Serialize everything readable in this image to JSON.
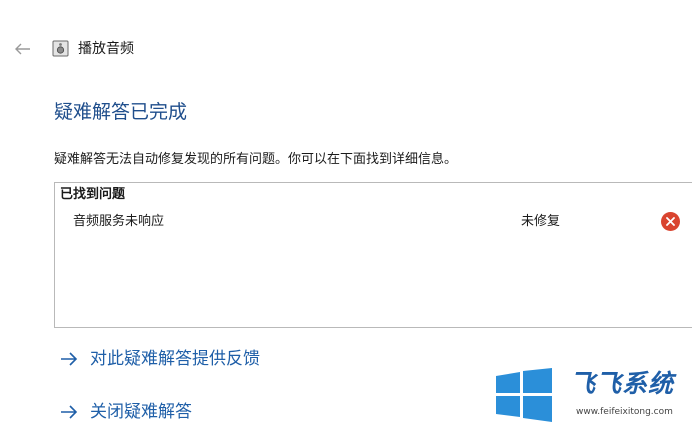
{
  "header": {
    "back_icon": "back-arrow-icon",
    "app_icon": "speaker-icon",
    "title": "播放音频"
  },
  "main": {
    "heading": "疑难解答已完成",
    "description": "疑难解答无法自动修复发现的所有问题。你可以在下面找到详细信息。",
    "issues": {
      "header": "已找到问题",
      "items": [
        {
          "name": "音频服务未响应",
          "status": "未修复",
          "status_icon": "error-x-icon",
          "status_color": "#d9442f"
        }
      ]
    },
    "links": [
      {
        "icon": "arrow-right-icon",
        "label": "对此疑难解答提供反馈"
      },
      {
        "icon": "arrow-right-icon",
        "label": "关闭疑难解答"
      }
    ]
  },
  "watermark": {
    "brand": "飞飞系统",
    "url": "www.feifeixitong.com",
    "brand_color": "#1f5fa8",
    "logo": "windows-logo-icon"
  },
  "colors": {
    "heading": "#1f4e8c",
    "link": "#1f5fa8",
    "border": "#b9b9b9"
  }
}
